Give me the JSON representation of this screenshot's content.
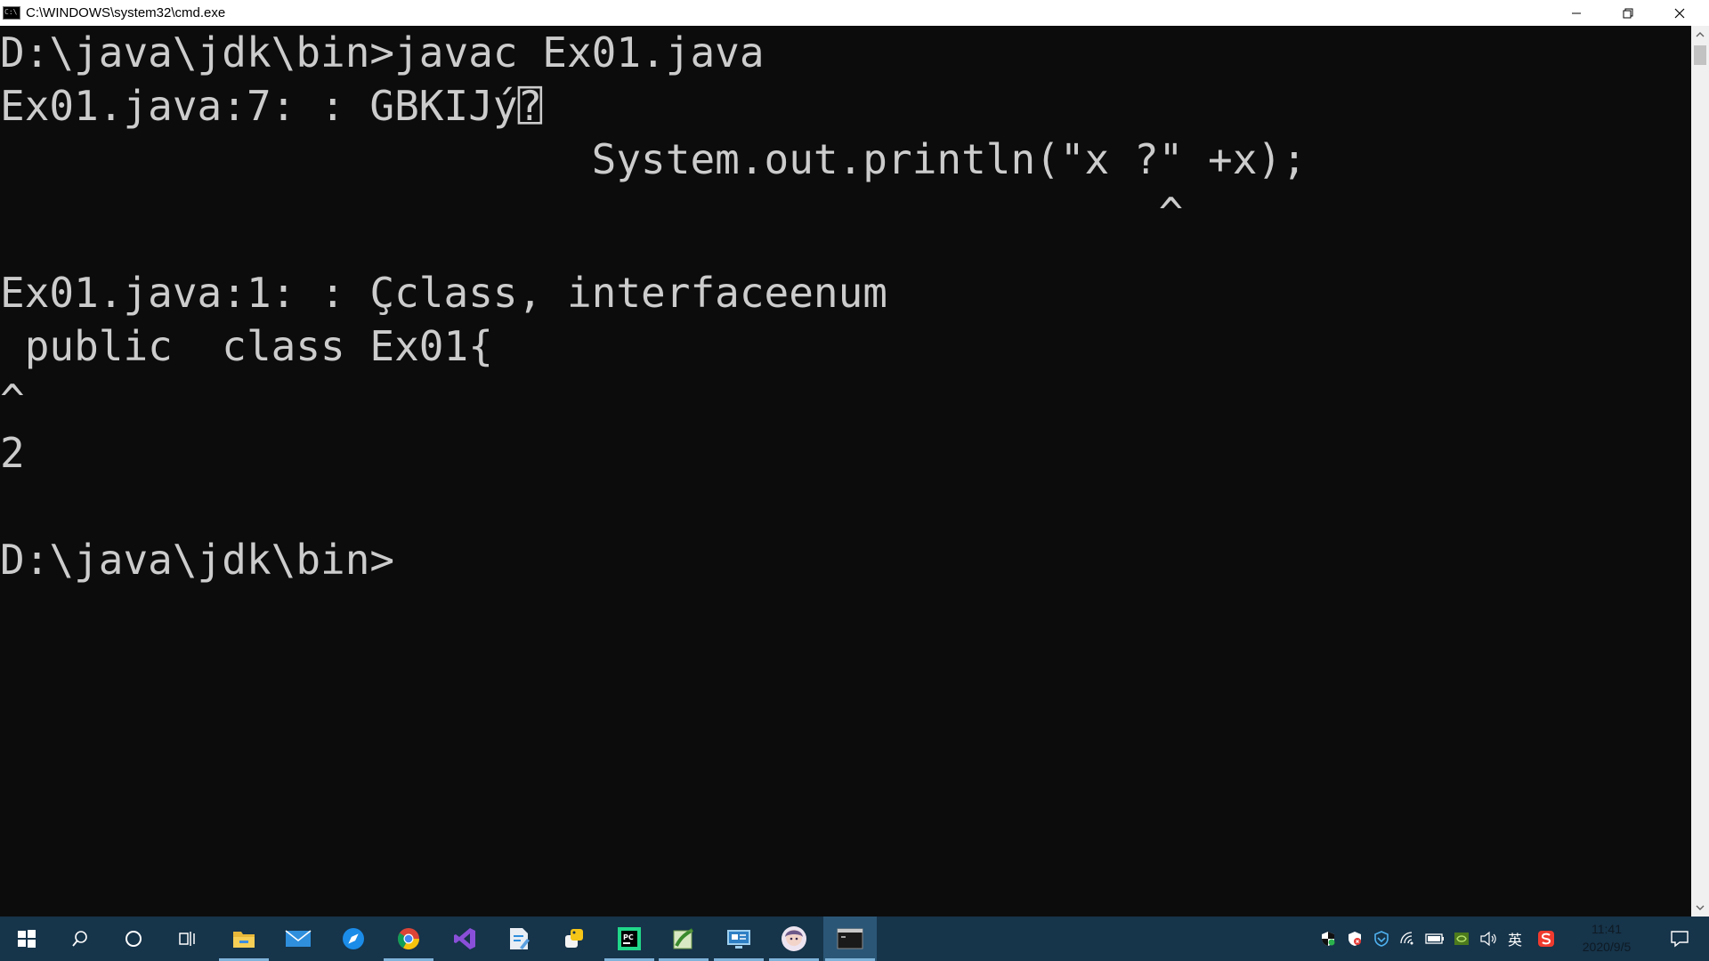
{
  "window": {
    "title": "C:\\WINDOWS\\system32\\cmd.exe",
    "icon_label": "C:\\",
    "controls": {
      "minimize_icon": "minimize-icon",
      "maximize_icon": "restore-icon",
      "close_icon": "close-icon"
    }
  },
  "console": {
    "lines": [
      "D:\\java\\jdk\\bin>javac Ex01.java",
      "Ex01.java:7: : GBKIJý⍰",
      "                        System.out.println(\"x ?\" +x);",
      "                                               ^",
      "",
      "Ex01.java:1: : Çclass, interfaceenum",
      " public  class Ex01{",
      "^",
      "2",
      "",
      "D:\\java\\jdk\\bin>"
    ],
    "foreground": "#cccccc",
    "background": "#0c0c0c"
  },
  "taskbar": {
    "background": "#16344a",
    "apps": [
      {
        "name": "start-icon",
        "running": false,
        "active": false
      },
      {
        "name": "search-icon",
        "running": false,
        "active": false
      },
      {
        "name": "cortana-icon",
        "running": false,
        "active": false
      },
      {
        "name": "task-view-icon",
        "running": false,
        "active": false
      },
      {
        "name": "file-explorer-icon",
        "running": true,
        "active": false
      },
      {
        "name": "mail-icon",
        "running": false,
        "active": false
      },
      {
        "name": "browser-icon",
        "running": false,
        "active": false
      },
      {
        "name": "chrome-icon",
        "running": true,
        "active": false
      },
      {
        "name": "visual-studio-icon",
        "running": false,
        "active": false
      },
      {
        "name": "document-editor-icon",
        "running": false,
        "active": false
      },
      {
        "name": "python-icon",
        "running": false,
        "active": false
      },
      {
        "name": "pycharm-icon",
        "running": true,
        "active": false
      },
      {
        "name": "notepad-plus-icon",
        "running": true,
        "active": false
      },
      {
        "name": "remote-desktop-icon",
        "running": true,
        "active": false
      },
      {
        "name": "avatar-app-icon",
        "running": true,
        "active": false
      },
      {
        "name": "cmd-icon",
        "running": true,
        "active": true
      }
    ],
    "tray": [
      "security-shield-icon",
      "antivirus-icon",
      "vpn-icon",
      "wifi-icon",
      "battery-icon",
      "nvidia-icon",
      "volume-icon",
      "ime-indicator",
      "sogou-icon"
    ],
    "ime_label": "英",
    "clock": {
      "time": "11:41",
      "date": "2020/9/5"
    },
    "notification_icon": "action-center-icon"
  }
}
